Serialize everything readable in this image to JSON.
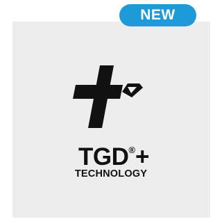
{
  "badge": {
    "label": "NEW",
    "color": "#1e9ad8"
  },
  "card": {
    "background": "#ededed"
  },
  "logo": {
    "icon": "cross-with-diamond-icon",
    "brand": "TGD",
    "registered_mark": "®",
    "plus": "+",
    "subtitle": "TECHNOLOGY"
  }
}
